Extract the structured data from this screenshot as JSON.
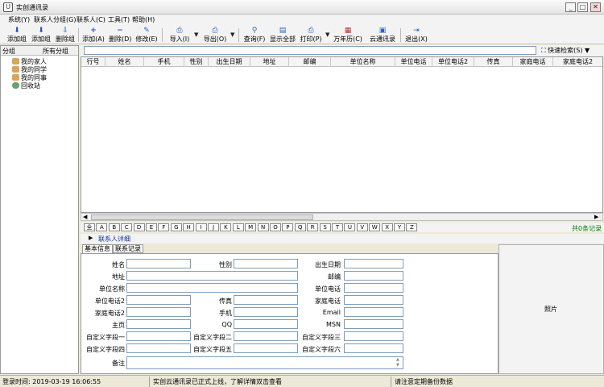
{
  "window": {
    "title": "实创通讯录",
    "min": "_",
    "max": "□",
    "close": "✕"
  },
  "menu": [
    "系统(Y)",
    "联系人分组(G)",
    "联系人(C)",
    "工具(T)",
    "帮助(H)"
  ],
  "toolbar": {
    "add_group": "添加组",
    "add_group2": "添加组",
    "del_group": "删除组",
    "add": "添加(A)",
    "delete": "删除(D)",
    "edit": "修改(E)",
    "import": "导入(I)",
    "export": "导出(O)",
    "query": "查询(F)",
    "show_all": "显示全部",
    "print": "打印(P)",
    "calendar": "万年历(C)",
    "cloud": "云通讯录",
    "exit": "退出(X)"
  },
  "sidebar": {
    "col1": "分组",
    "col2": "所有分组",
    "items": [
      "我的家人",
      "我的同学",
      "我的同事",
      "回收站"
    ]
  },
  "search": {
    "value": "",
    "quick": "快速检索(S)"
  },
  "grid": {
    "columns": [
      "行号",
      "姓名",
      "手机",
      "性别",
      "出生日期",
      "地址",
      "邮编",
      "单位名称",
      "单位电话",
      "单位电话2",
      "传真",
      "家庭电话",
      "家庭电话2"
    ],
    "rows": []
  },
  "alpha": [
    "全",
    "A",
    "B",
    "C",
    "D",
    "E",
    "F",
    "G",
    "H",
    "I",
    "J",
    "K",
    "L",
    "M",
    "N",
    "O",
    "P",
    "Q",
    "R",
    "S",
    "T",
    "U",
    "V",
    "W",
    "X",
    "Y",
    "Z"
  ],
  "total": "共0条记录",
  "detail": {
    "header": "联系人详细",
    "tab1": "基本信息",
    "tab2": "联系记录",
    "photo": "照片"
  },
  "form": {
    "name": "姓名",
    "gender": "性别",
    "birth": "出生日期",
    "address": "地址",
    "zip": "邮编",
    "company": "单位名称",
    "company_phone": "单位电话",
    "company_phone2": "单位电话2",
    "fax": "传真",
    "home_phone": "家庭电话",
    "home_phone2": "家庭电话2",
    "mobile": "手机",
    "email": "Email",
    "homepage": "主页",
    "qq": "QQ",
    "msn": "MSN",
    "custom1": "自定义字段一",
    "custom2": "自定义字段二",
    "custom3": "自定义字段三",
    "custom4": "自定义字段四",
    "custom5": "自定义字段五",
    "custom6": "自定义字段六",
    "note": "备注"
  },
  "status": {
    "login": "登录时间: 2019-03-19 16:06:55",
    "notice": "实创云通讯录已正式上线，了解详情双击查看",
    "tip": "请注意定期备份数据"
  }
}
